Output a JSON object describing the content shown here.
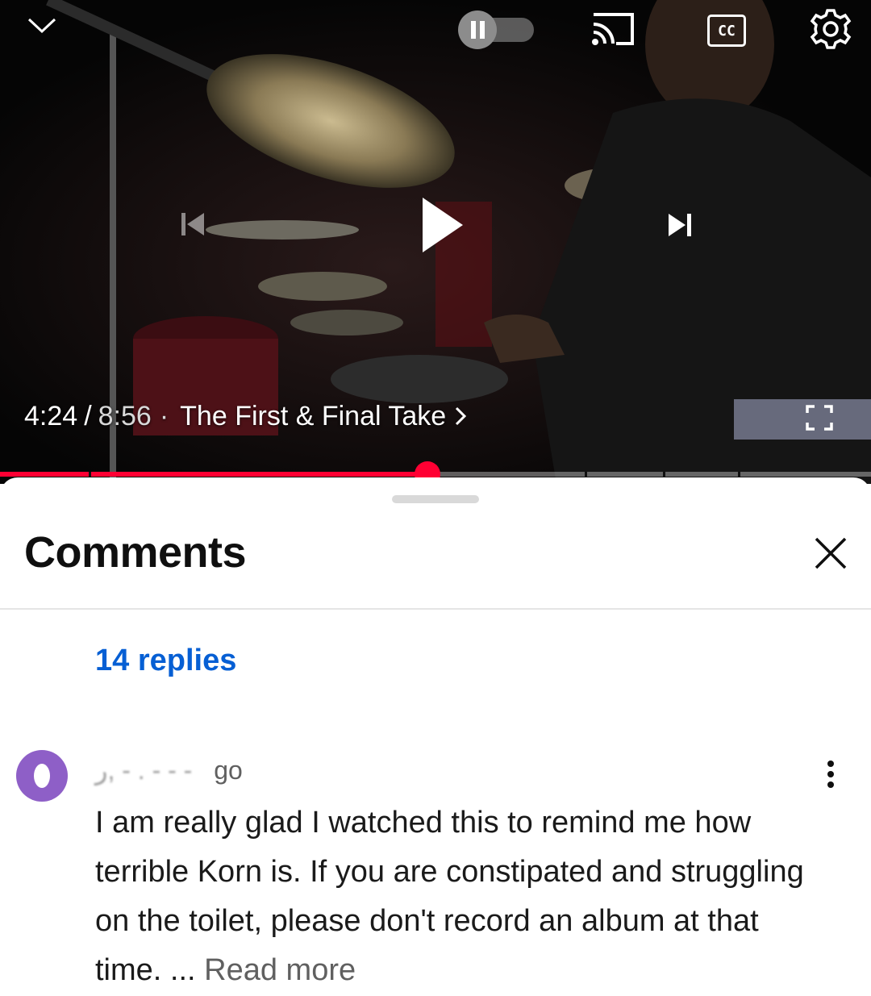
{
  "player": {
    "current_time": "4:24",
    "separator": "/",
    "duration": "8:56",
    "dot": "·",
    "chapter_title": "The First & Final Take",
    "progress_fraction": 0.491,
    "autoplay_state": "paused",
    "icons": {
      "collapse": "chevron-down-icon",
      "autoplay": "autoplay-toggle-icon",
      "cast": "cast-icon",
      "captions": "cc-icon",
      "settings": "gear-icon",
      "previous": "skip-previous-icon",
      "play": "play-icon",
      "next": "skip-next-icon",
      "fullscreen": "fullscreen-icon",
      "chapter_arrow": "chevron-right-icon"
    },
    "cc_label": "CC",
    "accent_color": "#ff0033"
  },
  "comments": {
    "title": "Comments",
    "replies_label": "14 replies",
    "replies_color": "#065fd4",
    "close_icon": "close-icon",
    "items": [
      {
        "author_obscured": "ر, -  .  - - -",
        "time_suffix": "go",
        "avatar_color": "#8e5fc7",
        "text": "I am really glad I watched this to remind me how terrible Korn is. If you are constipated and struggling on the toilet, please don't record an album at that time. ...",
        "read_more": "Read more",
        "menu_icon": "more-vertical-icon"
      }
    ]
  }
}
